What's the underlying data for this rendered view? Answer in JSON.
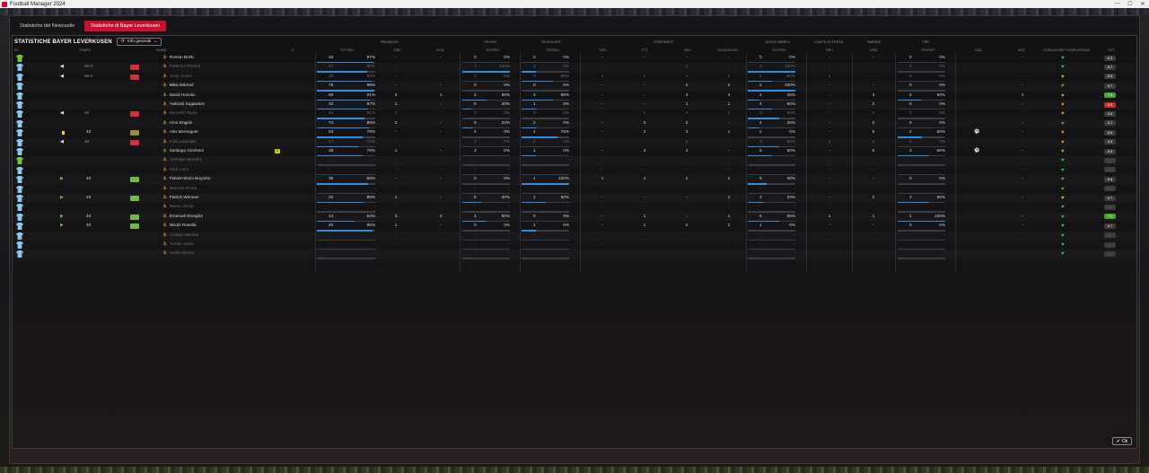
{
  "window": {
    "title": "Football Manager 2024"
  },
  "tabs": [
    {
      "label": "Statistiche del Newcastle",
      "active": false
    },
    {
      "label": "Statistiche di Bayer Leverkusen",
      "active": true
    }
  ],
  "panel": {
    "title": "STATISTICHE BAYER LEVERKUSEN",
    "view_button": "Info generali"
  },
  "groups": {
    "passaggi": "PASSAGGI",
    "cross": "CROSS",
    "scivolate": "SCIVOLATE",
    "contrasti": "CONTRASTI",
    "gioco_aereo": "GIOCO AEREO",
    "colpo_di_testa": "COLPO DI TESTA",
    "parate": "PARATE",
    "tiri": "TIRI"
  },
  "columns": {
    "ruolo": "RL",
    "tempo": "TEMPO",
    "nome": "NOME",
    "cap": "C",
    "pass_tot": "TOT/RIU",
    "pass_dec": "DEC",
    "pass_occ": "OCN",
    "cross_tot": "TNT/RIU",
    "sciv_tot": "TNT/RIU",
    "contr_dec": "DEC",
    "contr_ftt": "FTT",
    "contr_rec": "REC",
    "contr_salv": "SALVATAGGI",
    "aereo_tot": "TNT/RIU",
    "testa_dec": "DEC",
    "parate_drb": "DRB",
    "tiri_tot": "TNT/INP",
    "gol": "GOL",
    "ass": "ASS",
    "condizione": "CONDIZIONE COMPLESSIVA",
    "vot": "VOT"
  },
  "accent": "#c8102e",
  "ok_label": "Ok",
  "players": [
    {
      "name": "Roman Bürki",
      "dim": false,
      "gk": true,
      "tempo": "",
      "sub": "",
      "card": false,
      "captain": false,
      "pass": [
        "34",
        "97%"
      ],
      "pass_pct": 0.97,
      "pdec": "-",
      "pocc": "-",
      "cross": [
        "0",
        "0%"
      ],
      "cross_pct": 0,
      "sciv": [
        "0",
        "0%"
      ],
      "sciv_pct": 0,
      "cdec": "-",
      "cftt": "-",
      "crec": "-",
      "csalv": "-",
      "aereo": [
        "0",
        "0%"
      ],
      "aereo_pct": 0,
      "tdec": "-",
      "drb": "-",
      "tiri": [
        "0",
        "0%"
      ],
      "tiri_pct": 0,
      "gol": "",
      "ass": "-",
      "heart": "#2ecc40",
      "vot": "6.3",
      "vot_color": "#3c3c3c"
    },
    {
      "name": "Federico Pereira",
      "dim": true,
      "gk": false,
      "tempo": "66-0",
      "sub": "out",
      "card": false,
      "captain": false,
      "pass": [
        "22",
        "86%"
      ],
      "pass_pct": 0.86,
      "pdec": "-",
      "pocc": "-",
      "cross": [
        "1",
        "100%"
      ],
      "cross_pct": 1,
      "sciv": [
        "1",
        "0%"
      ],
      "sciv_pct": 0.3,
      "cdec": "-",
      "cftt": "-",
      "crec": "1",
      "csalv": "-",
      "aereo": [
        "2",
        "100%"
      ],
      "aereo_pct": 1,
      "tdec": "-",
      "drb": "-",
      "tiri": [
        "0",
        "0%"
      ],
      "tiri_pct": 0,
      "gol": "",
      "ass": "-",
      "heart": "#2ecc40",
      "vot": "6.7",
      "vot_color": "#3c3c3c"
    },
    {
      "name": "Josip Šutalo",
      "dim": true,
      "gk": false,
      "tempo": "66-0",
      "sub": "out",
      "card": false,
      "captain": false,
      "pass": [
        "30",
        "93%"
      ],
      "pass_pct": 0.93,
      "pdec": "-",
      "pocc": "-",
      "cross": [
        "0",
        "0%"
      ],
      "cross_pct": 0,
      "sciv": [
        "3",
        "66%"
      ],
      "sciv_pct": 0.66,
      "cdec": "2",
      "cftt": "1",
      "crec": "1",
      "csalv": "2",
      "aereo": [
        "4",
        "50%"
      ],
      "aereo_pct": 0.5,
      "tdec": "1",
      "drb": "-",
      "tiri": [
        "0",
        "0%"
      ],
      "tiri_pct": 0,
      "gol": "",
      "ass": "-",
      "heart": "#a8d830",
      "vot": "6.6",
      "vot_color": "#3c3c3c"
    },
    {
      "name": "Mika Mármol",
      "dim": false,
      "gk": false,
      "tempo": "",
      "sub": "",
      "card": false,
      "captain": false,
      "pass": [
        "75",
        "98%"
      ],
      "pass_pct": 0.98,
      "pdec": "-",
      "pocc": "-",
      "cross": [
        "0",
        "0%"
      ],
      "cross_pct": 0,
      "sciv": [
        "0",
        "0%"
      ],
      "sciv_pct": 0,
      "cdec": "-",
      "cftt": "-",
      "crec": "2",
      "csalv": "2",
      "aereo": [
        "2",
        "100%"
      ],
      "aereo_pct": 1,
      "tdec": "-",
      "drb": "-",
      "tiri": [
        "0",
        "0%"
      ],
      "tiri_pct": 0,
      "gol": "",
      "ass": "-",
      "heart": "#2ecc40",
      "vot": "6.7",
      "vot_color": "#3c3c3c"
    },
    {
      "name": "David Hancko",
      "dim": false,
      "gk": false,
      "tempo": "",
      "sub": "",
      "card": false,
      "captain": false,
      "pass": [
        "60",
        "91%"
      ],
      "pass_pct": 0.91,
      "pdec": "3",
      "pocc": "1",
      "cross": [
        "2",
        "50%"
      ],
      "cross_pct": 0.5,
      "sciv": [
        "3",
        "66%"
      ],
      "sciv_pct": 0.66,
      "cdec": "-",
      "cftt": "-",
      "crec": "3",
      "csalv": "4",
      "aereo": [
        "4",
        "25%"
      ],
      "aereo_pct": 0.25,
      "tdec": "-",
      "drb": "3",
      "tiri": [
        "2",
        "50%"
      ],
      "tiri_pct": 0.5,
      "gol": "",
      "ass": "1",
      "heart": "#e8a020",
      "vot": "7.5",
      "vot_color": "#4aa52e"
    },
    {
      "name": "Yukinari Sugawara",
      "dim": false,
      "gk": false,
      "tempo": "",
      "sub": "",
      "card": false,
      "captain": false,
      "pass": [
        "32",
        "87%"
      ],
      "pass_pct": 0.87,
      "pdec": "1",
      "pocc": "-",
      "cross": [
        "5",
        "20%"
      ],
      "cross_pct": 0.2,
      "sciv": [
        "1",
        "0%"
      ],
      "sciv_pct": 0.3,
      "cdec": "-",
      "cftt": "-",
      "crec": "1",
      "csalv": "1",
      "aereo": [
        "4",
        "50%"
      ],
      "aereo_pct": 0.5,
      "tdec": "-",
      "drb": "2",
      "tiri": [
        "0",
        "0%"
      ],
      "tiri_pct": 0,
      "gol": "",
      "ass": "-",
      "heart": "#e8a020",
      "vot": "5.5",
      "vot_color": "#c9302c"
    },
    {
      "name": "Kenneth Taylor",
      "dim": true,
      "gk": false,
      "tempo": "60",
      "sub": "out",
      "card": false,
      "captain": false,
      "pass": [
        "44",
        "81%"
      ],
      "pass_pct": 0.81,
      "pdec": "1",
      "pocc": "-",
      "cross": [
        "2",
        "0%"
      ],
      "cross_pct": 0,
      "sciv": [
        "0",
        "0%"
      ],
      "sciv_pct": 0,
      "cdec": "-",
      "cftt": "1",
      "crec": "2",
      "csalv": "1",
      "aereo": [
        "3",
        "66%"
      ],
      "aereo_pct": 0.66,
      "tdec": "-",
      "drb": "1",
      "tiri": [
        "0",
        "0%"
      ],
      "tiri_pct": 0,
      "gol": "",
      "ass": "-",
      "heart": "#e8a020",
      "vot": "6.6",
      "vot_color": "#3c3c3c"
    },
    {
      "name": "Arne Engels",
      "dim": false,
      "gk": false,
      "tempo": "",
      "sub": "",
      "card": false,
      "captain": false,
      "pass": [
        "74",
        "89%"
      ],
      "pass_pct": 0.89,
      "pdec": "2",
      "pocc": "-",
      "cross": [
        "9",
        "22%"
      ],
      "cross_pct": 0.22,
      "sciv": [
        "2",
        "0%"
      ],
      "sciv_pct": 0.3,
      "cdec": "-",
      "cftt": "2",
      "crec": "2",
      "csalv": "-",
      "aereo": [
        "4",
        "25%"
      ],
      "aereo_pct": 0.25,
      "tdec": "-",
      "drb": "2",
      "tiri": [
        "0",
        "0%"
      ],
      "tiri_pct": 0,
      "gol": "",
      "ass": "-",
      "heart": "#2ecc40",
      "vot": "6.7",
      "vot_color": "#3c3c3c"
    },
    {
      "name": "Alex Berenguer",
      "dim": false,
      "gk": false,
      "tempo": "40",
      "sub": "yellow",
      "card": true,
      "captain": false,
      "pass": [
        "53",
        "79%"
      ],
      "pass_pct": 0.79,
      "pdec": "-",
      "pocc": "-",
      "cross": [
        "4",
        "0%"
      ],
      "cross_pct": 0,
      "sciv": [
        "4",
        "75%"
      ],
      "sciv_pct": 0.75,
      "cdec": "-",
      "cftt": "3",
      "crec": "3",
      "csalv": "1",
      "aereo": [
        "2",
        "0%"
      ],
      "aereo_pct": 0,
      "tdec": "-",
      "drb": "5",
      "tiri": [
        "2",
        "50%"
      ],
      "tiri_pct": 0.5,
      "gol": "ball",
      "ass": "-",
      "heart": "#e8a020",
      "vot": "6.8",
      "vot_color": "#3c3c3c"
    },
    {
      "name": "Fotis Ioannidis",
      "dim": true,
      "gk": false,
      "tempo": "40",
      "sub": "out",
      "card": false,
      "captain": false,
      "pass": [
        "17",
        "70%"
      ],
      "pass_pct": 0.7,
      "pdec": "-",
      "pocc": "-",
      "cross": [
        "1",
        "0%"
      ],
      "cross_pct": 0,
      "sciv": [
        "0",
        "0%"
      ],
      "sciv_pct": 0,
      "cdec": "-",
      "cftt": "-",
      "crec": "1",
      "csalv": "-",
      "aereo": [
        "3",
        "66%"
      ],
      "aereo_pct": 0.66,
      "tdec": "1",
      "drb": "2",
      "tiri": [
        "0",
        "0%"
      ],
      "tiri_pct": 0,
      "gol": "",
      "ass": "-",
      "heart": "#e8a020",
      "vot": "6.5",
      "vot_color": "#3c3c3c"
    },
    {
      "name": "Santiago Giménez",
      "dim": false,
      "gk": false,
      "tempo": "",
      "sub": "",
      "card": false,
      "captain": true,
      "pass": [
        "38",
        "78%"
      ],
      "pass_pct": 0.78,
      "pdec": "1",
      "pocc": "-",
      "cross": [
        "3",
        "0%"
      ],
      "cross_pct": 0,
      "sciv": [
        "1",
        "0%"
      ],
      "sciv_pct": 0.3,
      "cdec": "-",
      "cftt": "3",
      "crec": "2",
      "csalv": "-",
      "aereo": [
        "6",
        "50%"
      ],
      "aereo_pct": 0.5,
      "tdec": "-",
      "drb": "6",
      "tiri": [
        "3",
        "66%"
      ],
      "tiri_pct": 0.66,
      "gol": "ball",
      "ass": "-",
      "heart": "#e8a020",
      "vot": "6.9",
      "vot_color": "#3c3c3c"
    },
    {
      "name": "Christian Mendez",
      "dim": true,
      "gk": true,
      "tempo": "",
      "sub": "",
      "card": false,
      "captain": false,
      "pass": [
        "-",
        "-"
      ],
      "pass_pct": 0,
      "pdec": "-",
      "pocc": "-",
      "cross": [
        "-",
        "-"
      ],
      "cross_pct": 0,
      "sciv": [
        "-",
        "-"
      ],
      "sciv_pct": 0,
      "cdec": "-",
      "cftt": "-",
      "crec": "-",
      "csalv": "-",
      "aereo": [
        "-",
        "-"
      ],
      "aereo_pct": 0,
      "tdec": "-",
      "drb": "-",
      "tiri": [
        "-",
        "-"
      ],
      "tiri_pct": 0,
      "gol": "",
      "ass": "-",
      "heart": "#2ecc40",
      "vot": "-",
      "vot_color": "#3c3c3c"
    },
    {
      "name": "Saúl Coco",
      "dim": true,
      "gk": false,
      "tempo": "",
      "sub": "",
      "card": false,
      "captain": false,
      "pass": [
        "-",
        "-"
      ],
      "pass_pct": 0,
      "pdec": "-",
      "pocc": "-",
      "cross": [
        "-",
        "-"
      ],
      "cross_pct": 0,
      "sciv": [
        "-",
        "-"
      ],
      "sciv_pct": 0,
      "cdec": "-",
      "cftt": "-",
      "crec": "-",
      "csalv": "-",
      "aereo": [
        "-",
        "-"
      ],
      "aereo_pct": 0,
      "tdec": "-",
      "drb": "-",
      "tiri": [
        "-",
        "-"
      ],
      "tiri_pct": 0,
      "gol": "",
      "ass": "-",
      "heart": "#2ecc40",
      "vot": "-",
      "vot_color": "#3c3c3c"
    },
    {
      "name": "Flavien-Enzo Boyomo",
      "dim": false,
      "gk": false,
      "tempo": "40",
      "sub": "in",
      "card": false,
      "captain": false,
      "pass": [
        "36",
        "88%"
      ],
      "pass_pct": 0.88,
      "pdec": "-",
      "pocc": "-",
      "cross": [
        "0",
        "0%"
      ],
      "cross_pct": 0,
      "sciv": [
        "1",
        "100%"
      ],
      "sciv_pct": 1,
      "cdec": "1",
      "cftt": "1",
      "crec": "2",
      "csalv": "2",
      "aereo": [
        "5",
        "40%"
      ],
      "aereo_pct": 0.4,
      "tdec": "-",
      "drb": "-",
      "tiri": [
        "0",
        "0%"
      ],
      "tiri_pct": 0,
      "gol": "",
      "ass": "-",
      "heart": "#2ecc40",
      "vot": "6.6",
      "vot_color": "#3c3c3c"
    },
    {
      "name": "Marcelo Reina",
      "dim": true,
      "gk": false,
      "tempo": "",
      "sub": "",
      "card": false,
      "captain": false,
      "pass": [
        "-",
        "-"
      ],
      "pass_pct": 0,
      "pdec": "-",
      "pocc": "-",
      "cross": [
        "-",
        "-"
      ],
      "cross_pct": 0,
      "sciv": [
        "-",
        "-"
      ],
      "sciv_pct": 0,
      "cdec": "-",
      "cftt": "-",
      "crec": "-",
      "csalv": "-",
      "aereo": [
        "-",
        "-"
      ],
      "aereo_pct": 0,
      "tdec": "-",
      "drb": "-",
      "tiri": [
        "-",
        "-"
      ],
      "tiri_pct": 0,
      "gol": "",
      "ass": "-",
      "heart": "#2ecc40",
      "vot": "-",
      "vot_color": "#3c3c3c"
    },
    {
      "name": "Patrick Wimmer",
      "dim": false,
      "gk": false,
      "tempo": "40",
      "sub": "in",
      "card": false,
      "captain": false,
      "pass": [
        "20",
        "80%"
      ],
      "pass_pct": 0.8,
      "pdec": "1",
      "pocc": "-",
      "cross": [
        "5",
        "40%"
      ],
      "cross_pct": 0.4,
      "sciv": [
        "2",
        "50%"
      ],
      "sciv_pct": 0.5,
      "cdec": "-",
      "cftt": "-",
      "crec": "-",
      "csalv": "1",
      "aereo": [
        "3",
        "33%"
      ],
      "aereo_pct": 0.33,
      "tdec": "-",
      "drb": "2",
      "tiri": [
        "3",
        "66%"
      ],
      "tiri_pct": 0.66,
      "gol": "",
      "ass": "-",
      "heart": "#a8d830",
      "vot": "6.7",
      "vot_color": "#3c3c3c"
    },
    {
      "name": "Mauro Júnior",
      "dim": true,
      "gk": false,
      "tempo": "",
      "sub": "",
      "card": false,
      "captain": false,
      "pass": [
        "-",
        "-"
      ],
      "pass_pct": 0,
      "pdec": "-",
      "pocc": "-",
      "cross": [
        "-",
        "-"
      ],
      "cross_pct": 0,
      "sciv": [
        "-",
        "-"
      ],
      "sciv_pct": 0,
      "cdec": "-",
      "cftt": "-",
      "crec": "-",
      "csalv": "-",
      "aereo": [
        "-",
        "-"
      ],
      "aereo_pct": 0,
      "tdec": "-",
      "drb": "-",
      "tiri": [
        "-",
        "-"
      ],
      "tiri_pct": 0,
      "gol": "",
      "ass": "-",
      "heart": "#2ecc40",
      "vot": "-",
      "vot_color": "#3c3c3c"
    },
    {
      "name": "Emanuel Emegha",
      "dim": false,
      "gk": false,
      "tempo": "40",
      "sub": "in",
      "card": false,
      "captain": false,
      "pass": [
        "14",
        "64%"
      ],
      "pass_pct": 0.64,
      "pdec": "3",
      "pocc": "3",
      "cross": [
        "4",
        "50%"
      ],
      "cross_pct": 0.5,
      "sciv": [
        "0",
        "0%"
      ],
      "sciv_pct": 0,
      "cdec": "-",
      "cftt": "1",
      "crec": "-",
      "csalv": "1",
      "aereo": [
        "6",
        "66%"
      ],
      "aereo_pct": 0.66,
      "tdec": "1",
      "drb": "1",
      "tiri": [
        "1",
        "100%"
      ],
      "tiri_pct": 1,
      "gol": "",
      "ass": "-",
      "heart": "#2ecc40",
      "vot": "7.5",
      "vot_color": "#4aa52e"
    },
    {
      "name": "Nicolò Rovella",
      "dim": false,
      "gk": false,
      "tempo": "40",
      "sub": "in",
      "card": false,
      "captain": false,
      "pass": [
        "20",
        "95%"
      ],
      "pass_pct": 0.95,
      "pdec": "1",
      "pocc": "-",
      "cross": [
        "0",
        "0%"
      ],
      "cross_pct": 0,
      "sciv": [
        "1",
        "0%"
      ],
      "sciv_pct": 0.3,
      "cdec": "-",
      "cftt": "1",
      "crec": "2",
      "csalv": "2",
      "aereo": [
        "1",
        "0%"
      ],
      "aereo_pct": 0,
      "tdec": "-",
      "drb": "-",
      "tiri": [
        "0",
        "0%"
      ],
      "tiri_pct": 0,
      "gol": "",
      "ass": "-",
      "heart": "#2ecc40",
      "vot": "6.7",
      "vot_color": "#3c3c3c"
    },
    {
      "name": "Cristian Medina",
      "dim": true,
      "gk": false,
      "tempo": "",
      "sub": "",
      "card": false,
      "captain": false,
      "pass": [
        "-",
        "-"
      ],
      "pass_pct": 0,
      "pdec": "-",
      "pocc": "-",
      "cross": [
        "-",
        "-"
      ],
      "cross_pct": 0,
      "sciv": [
        "-",
        "-"
      ],
      "sciv_pct": 0,
      "cdec": "-",
      "cftt": "-",
      "crec": "-",
      "csalv": "-",
      "aereo": [
        "-",
        "-"
      ],
      "aereo_pct": 0,
      "tdec": "-",
      "drb": "-",
      "tiri": [
        "-",
        "-"
      ],
      "tiri_pct": 0,
      "gol": "",
      "ass": "-",
      "heart": "#2ecc40",
      "vot": "-",
      "vot_color": "#3c3c3c"
    },
    {
      "name": "Tomás Saldo",
      "dim": true,
      "gk": false,
      "tempo": "",
      "sub": "",
      "card": false,
      "captain": false,
      "pass": [
        "-",
        "-"
      ],
      "pass_pct": 0,
      "pdec": "-",
      "pocc": "-",
      "cross": [
        "-",
        "-"
      ],
      "cross_pct": 0,
      "sciv": [
        "-",
        "-"
      ],
      "sciv_pct": 0,
      "cdec": "-",
      "cftt": "-",
      "crec": "-",
      "csalv": "-",
      "aereo": [
        "-",
        "-"
      ],
      "aereo_pct": 0,
      "tdec": "-",
      "drb": "-",
      "tiri": [
        "-",
        "-"
      ],
      "tiri_pct": 0,
      "gol": "",
      "ass": "-",
      "heart": "#2ecc40",
      "vot": "-",
      "vot_color": "#3c3c3c"
    },
    {
      "name": "Archie Brown",
      "dim": true,
      "gk": false,
      "tempo": "",
      "sub": "",
      "card": false,
      "captain": false,
      "pass": [
        "-",
        "-"
      ],
      "pass_pct": 0,
      "pdec": "-",
      "pocc": "-",
      "cross": [
        "-",
        "-"
      ],
      "cross_pct": 0,
      "sciv": [
        "-",
        "-"
      ],
      "sciv_pct": 0,
      "cdec": "-",
      "cftt": "-",
      "crec": "-",
      "csalv": "-",
      "aereo": [
        "-",
        "-"
      ],
      "aereo_pct": 0,
      "tdec": "-",
      "drb": "-",
      "tiri": [
        "-",
        "-"
      ],
      "tiri_pct": 0,
      "gol": "",
      "ass": "-",
      "heart": "#2ecc40",
      "vot": "-",
      "vot_color": "#3c3c3c"
    }
  ]
}
